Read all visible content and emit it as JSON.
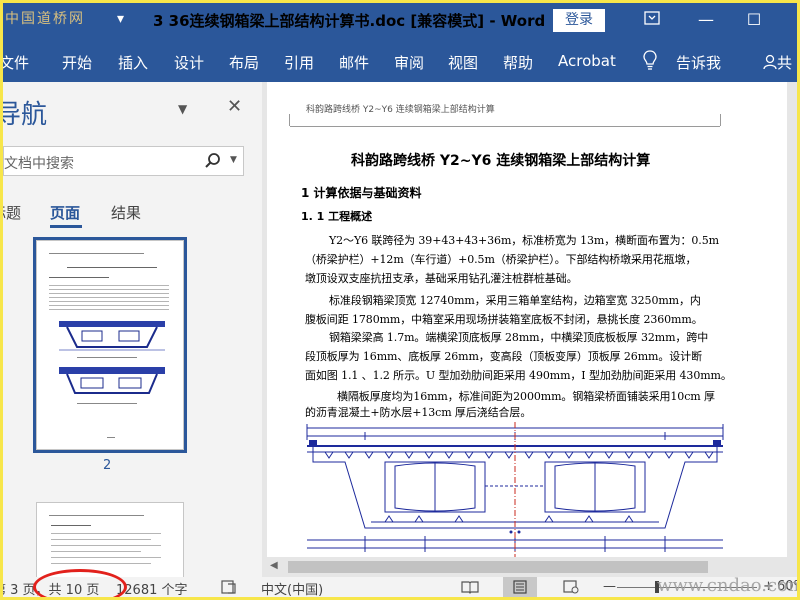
{
  "watermark_top": "中国道桥网",
  "window": {
    "quick_access": "▾",
    "title": "3 36连续钢箱梁上部结构计算书.doc [兼容模式]  -  Word",
    "login": "登录",
    "minimize": "—",
    "restore": "☐"
  },
  "ribbon": {
    "tabs": [
      "文件",
      "开始",
      "插入",
      "设计",
      "布局",
      "引用",
      "邮件",
      "审阅",
      "视图",
      "帮助",
      "Acrobat",
      "告诉我",
      "共"
    ]
  },
  "nav": {
    "title": "导航",
    "search_placeholder": "文档中搜索",
    "tabs": [
      "标题",
      "页面",
      "结果"
    ],
    "page_number": "2"
  },
  "document": {
    "header": "科韵路跨线桥 Y2~Y6 连续钢箱梁上部结构计算",
    "title": "科韵路跨线桥 Y2~Y6 连续钢箱梁上部结构计算",
    "heading1": "1  计算依据与基础资料",
    "heading2": "1. 1 工程概述",
    "paragraphs": [
      "Y2～Y6 联跨径为 39+43+43+36m，标准桥宽为 13m，横断面布置为：0.5m",
      "（桥梁护栏）+12m（车行道）+0.5m（桥梁护栏）。下部结构桥墩采用花瓶墩，",
      "墩顶设双支座抗扭支承，基础采用钻孔灌注桩群桩基础。",
      "标准段钢箱梁顶宽 12740mm，采用三箱单室结构，边箱室宽 3250mm，内",
      "腹板间距 1780mm，中箱室采用现场拼装箱室底板不封闭，悬挑长度 2360mm。",
      "钢箱梁梁高 1.7m。端横梁顶底板厚 28mm，中横梁顶底板板厚 32mm，跨中",
      "段顶板厚为 16mm、底板厚 26mm，变高段（顶板变厚）顶板厚 26mm。设计断",
      "面如图 1.1 、1.2 所示。U 型加劲肋间距采用 490mm，I 型加劲肋间距采用 430mm。",
      "横隔板厚度均为16mm，标准间距为2000mm。钢箱梁桥面铺装采用10cm 厚",
      "的沥青混凝土+防水层+13cm 厚后浇结合层。"
    ]
  },
  "status": {
    "page": "第 3 页，共 10 页",
    "words": "12681 个字",
    "language": "中文(中国)",
    "zoom_minus": "—",
    "zoom_plus": "+",
    "zoom": "60%"
  },
  "watermark_bottom": "www.cndao.com"
}
